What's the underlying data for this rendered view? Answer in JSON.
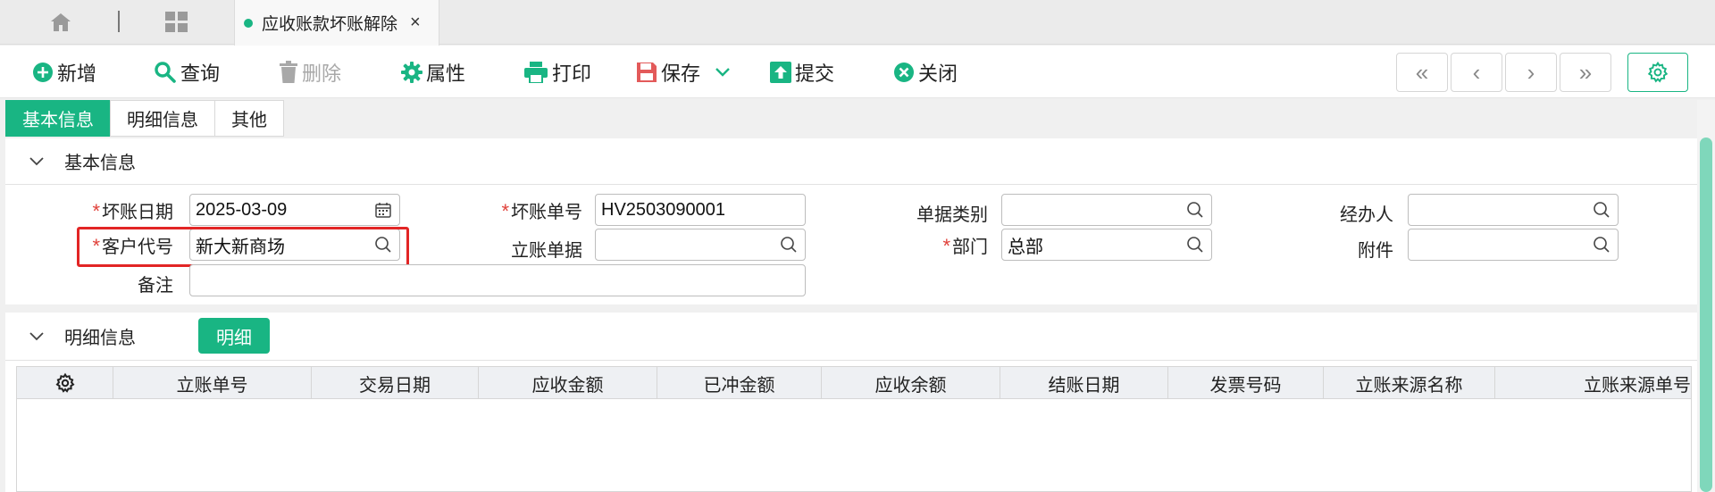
{
  "window": {
    "active_tab_title": "应收账款坏账解除",
    "close_tab_symbol": "×"
  },
  "toolbar": {
    "add": "新增",
    "query": "查询",
    "delete": "删除",
    "properties": "属性",
    "print": "打印",
    "save": "保存",
    "submit": "提交",
    "close": "关闭",
    "nav_first": "«",
    "nav_prev": "‹",
    "nav_next": "›",
    "nav_last": "»"
  },
  "subtabs": [
    "基本信息",
    "明细信息",
    "其他"
  ],
  "basic_section": {
    "title": "基本信息",
    "fields": {
      "bad_debt_date": {
        "label": "坏账日期",
        "value": "2025-03-09",
        "required": true
      },
      "bad_debt_no": {
        "label": "坏账单号",
        "value": "HV2503090001",
        "required": true
      },
      "doc_type": {
        "label": "单据类别",
        "value": ""
      },
      "handler": {
        "label": "经办人",
        "value": ""
      },
      "customer_code": {
        "label": "客户代号",
        "value": "新大新商场",
        "required": true
      },
      "account_doc": {
        "label": "立账单据",
        "value": ""
      },
      "department": {
        "label": "部门",
        "value": "总部",
        "required": true
      },
      "attachment": {
        "label": "附件",
        "value": ""
      },
      "remark": {
        "label": "备注",
        "value": ""
      }
    }
  },
  "detail_section": {
    "title": "明细信息",
    "detail_button": "明细",
    "columns": [
      "立账单号",
      "交易日期",
      "应收金额",
      "已冲金额",
      "应收余额",
      "结账日期",
      "发票号码",
      "立账来源名称",
      "立账来源单号"
    ]
  },
  "colors": {
    "accent": "#19b583",
    "required": "#e0413a",
    "highlight": "#e22525"
  }
}
